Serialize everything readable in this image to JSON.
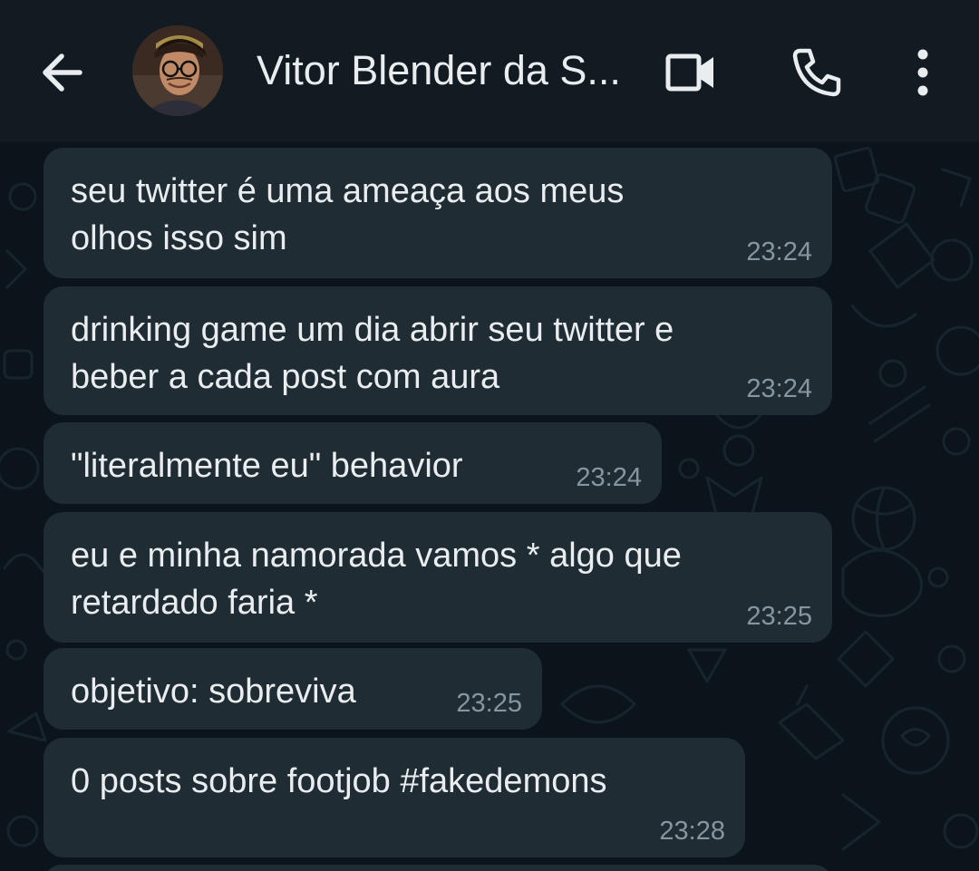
{
  "header": {
    "back_icon": "arrow-left-icon",
    "contact_name": "Vitor Blender da S...",
    "video_icon": "video-camera-icon",
    "call_icon": "phone-icon",
    "menu_icon": "more-vertical-icon"
  },
  "colors": {
    "header_bg": "#121b22",
    "chat_bg": "#0b141a",
    "bubble_bg": "#202c33",
    "text_primary": "#e9edef",
    "text_secondary": "#8696a0"
  },
  "messages": [
    {
      "text": "seu twitter é uma ameaça aos meus\nolhos isso sim",
      "time": "23:24"
    },
    {
      "text": "drinking game um dia abrir seu twitter e\nbeber a cada post com aura",
      "time": "23:24"
    },
    {
      "text": "\"literalmente eu\" behavior",
      "time": "23:24"
    },
    {
      "text": "eu e minha namorada vamos * algo que\nretardado faria *",
      "time": "23:25"
    },
    {
      "text": "objetivo: sobreviva",
      "time": "23:25"
    },
    {
      "text": "0 posts sobre footjob #fakedemons",
      "time": "23:28"
    }
  ]
}
